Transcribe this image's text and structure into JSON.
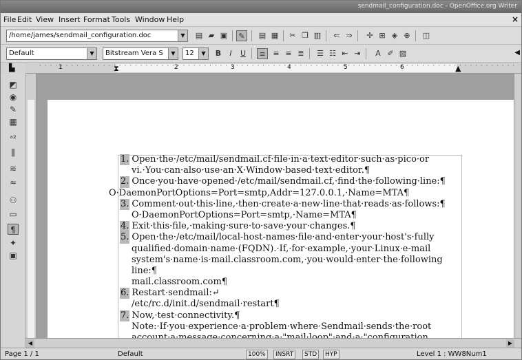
{
  "window": {
    "title": "sendmail_configuration.doc - OpenOffice.org Writer"
  },
  "menubar": [
    "File",
    "Edit",
    "View",
    "Insert",
    "Format",
    "Tools",
    "Window",
    "Help"
  ],
  "toolbar1": {
    "path": "/home/james/sendmail_configuration.doc"
  },
  "toolbar2": {
    "style": "Default",
    "font": "Bitstream Vera S",
    "size": "12"
  },
  "ruler": {
    "ticks": [
      "1",
      "2",
      "3",
      "4",
      "5",
      "6"
    ]
  },
  "document": {
    "lines": [
      {
        "num": "1.",
        "text": "Open·the·/etc/mail/sendmail.cf·file·in·a·text·editor·such·as·pico·or"
      },
      {
        "text": "vi.·You·can·also·use·an·X·Window·based·text·editor.¶",
        "indent": true
      },
      {
        "num": "2.",
        "text": "Once·you·have·opened·/etc/mail/sendmail.cf,·find·the·following·line:¶"
      },
      {
        "text": "O·DaemonPortOptions=Port=smtp,Addr=127.0.0.1,·Name=MTA¶",
        "outdent": true
      },
      {
        "num": "3.",
        "text": "Comment·out·this·line,·then·create·a·new·line·that·reads·as·follows:¶"
      },
      {
        "text": "O·DaemonPortOptions=Port=smtp,·Name=MTA¶",
        "indent": true
      },
      {
        "num": "4.",
        "text": "Exit·this·file,·making·sure·to·save·your·changes.¶"
      },
      {
        "num": "5.",
        "text": "Open·the·/etc/mail/local-host-names·file·and·enter·your·host's·fully"
      },
      {
        "text": "qualified·domain·name·(FQDN).·If,·for·example,·your·Linux·e-mail",
        "indent": true
      },
      {
        "text": "system's·name·is·mail.classroom.com,·you·would·enter·the·following",
        "indent": true
      },
      {
        "text": "line:¶",
        "indent": true
      },
      {
        "text": "mail.classroom.com¶",
        "indent": true
      },
      {
        "num": "6.",
        "text": "Restart·sendmail:↵"
      },
      {
        "text": "/etc/rc.d/init.d/sendmail·restart¶",
        "indent": true
      },
      {
        "num": "7.",
        "text": "Now,·test·connectivity.¶"
      },
      {
        "text": "Note:·If·you·experience·a·problem·where·Sendmail·sends·the·root",
        "indent": true
      },
      {
        "text": "account·a·message·concerning·a·\"mail·loop\"·and·a·\"configuration",
        "indent": true
      }
    ]
  },
  "statusbar": {
    "page": "Page 1 / 1",
    "style": "Default",
    "zoom": "100%",
    "insert": "INSRT",
    "std": "STD",
    "hyp": "HYP",
    "level": "Level 1 : WW8Num1"
  }
}
